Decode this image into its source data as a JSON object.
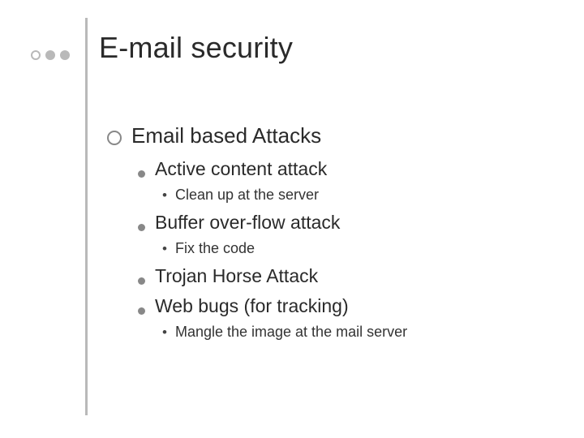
{
  "title": "E-mail security",
  "bullets": {
    "lvl1": "Email based Attacks",
    "items": [
      {
        "label": "Active content attack",
        "sub": "Clean up at the server"
      },
      {
        "label": "Buffer over-flow attack",
        "sub": "Fix the code"
      },
      {
        "label": "Trojan Horse Attack",
        "sub": null
      },
      {
        "label": "Web bugs (for tracking)",
        "sub": "Mangle the image at the mail server"
      }
    ]
  }
}
